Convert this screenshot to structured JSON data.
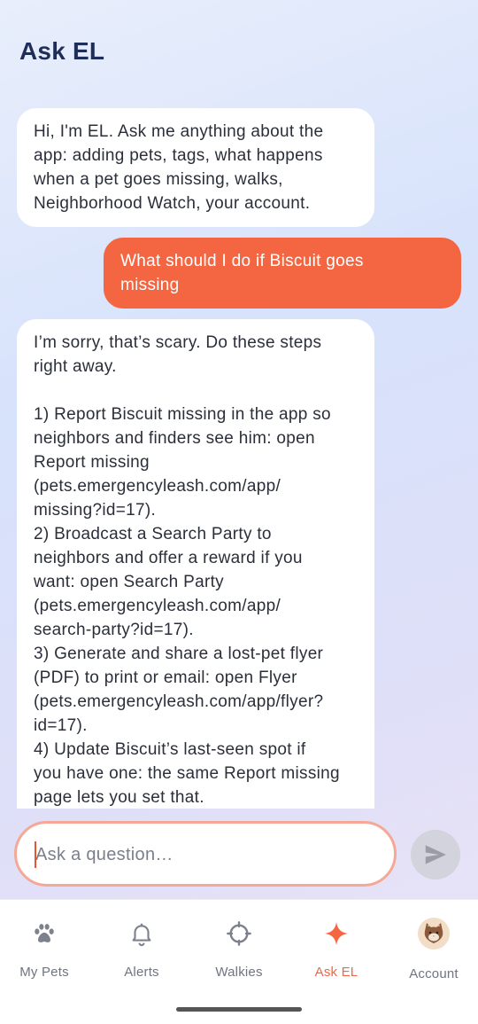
{
  "header": {
    "title": "Ask EL"
  },
  "messages": [
    {
      "role": "assistant",
      "text": "Hi, I'm EL. Ask me anything about the\napp: adding pets, tags, what happens\nwhen a pet goes missing, walks,\nNeighborhood Watch, your account."
    },
    {
      "role": "user",
      "text": "What should I do if Biscuit goes\nmissing"
    },
    {
      "role": "assistant",
      "text": "I’m sorry, that’s scary. Do these steps\nright away.\n\n1) Report Biscuit missing in the app so\nneighbors and finders see him: open\nReport missing\n(pets.emergencyleash.com/app/\nmissing?id=17).\n2) Broadcast a Search Party to\nneighbors and offer a reward if you\nwant: open Search Party\n(pets.emergencyleash.com/app/\nsearch-party?id=17).\n3) Generate and share a lost-pet flyer\n(PDF) to print or email: open Flyer\n(pets.emergencyleash.com/app/flyer?\nid=17).\n4) Update Biscuit’s last-seen spot if\nyou have one: the same Report missing\npage lets you set that."
    }
  ],
  "composer": {
    "placeholder": "Ask a question…",
    "value": ""
  },
  "tabs": [
    {
      "label": "My Pets",
      "icon": "paw-icon"
    },
    {
      "label": "Alerts",
      "icon": "bell-icon"
    },
    {
      "label": "Walkies",
      "icon": "crosshair-icon"
    },
    {
      "label": "Ask EL",
      "icon": "sparkle-icon",
      "active": true
    },
    {
      "label": "Account",
      "icon": "cat-avatar-icon"
    }
  ],
  "colors": {
    "accent": "#f46641",
    "title": "#1f2d5a",
    "user_bubble": "#f46641",
    "bot_bubble": "#ffffff"
  }
}
